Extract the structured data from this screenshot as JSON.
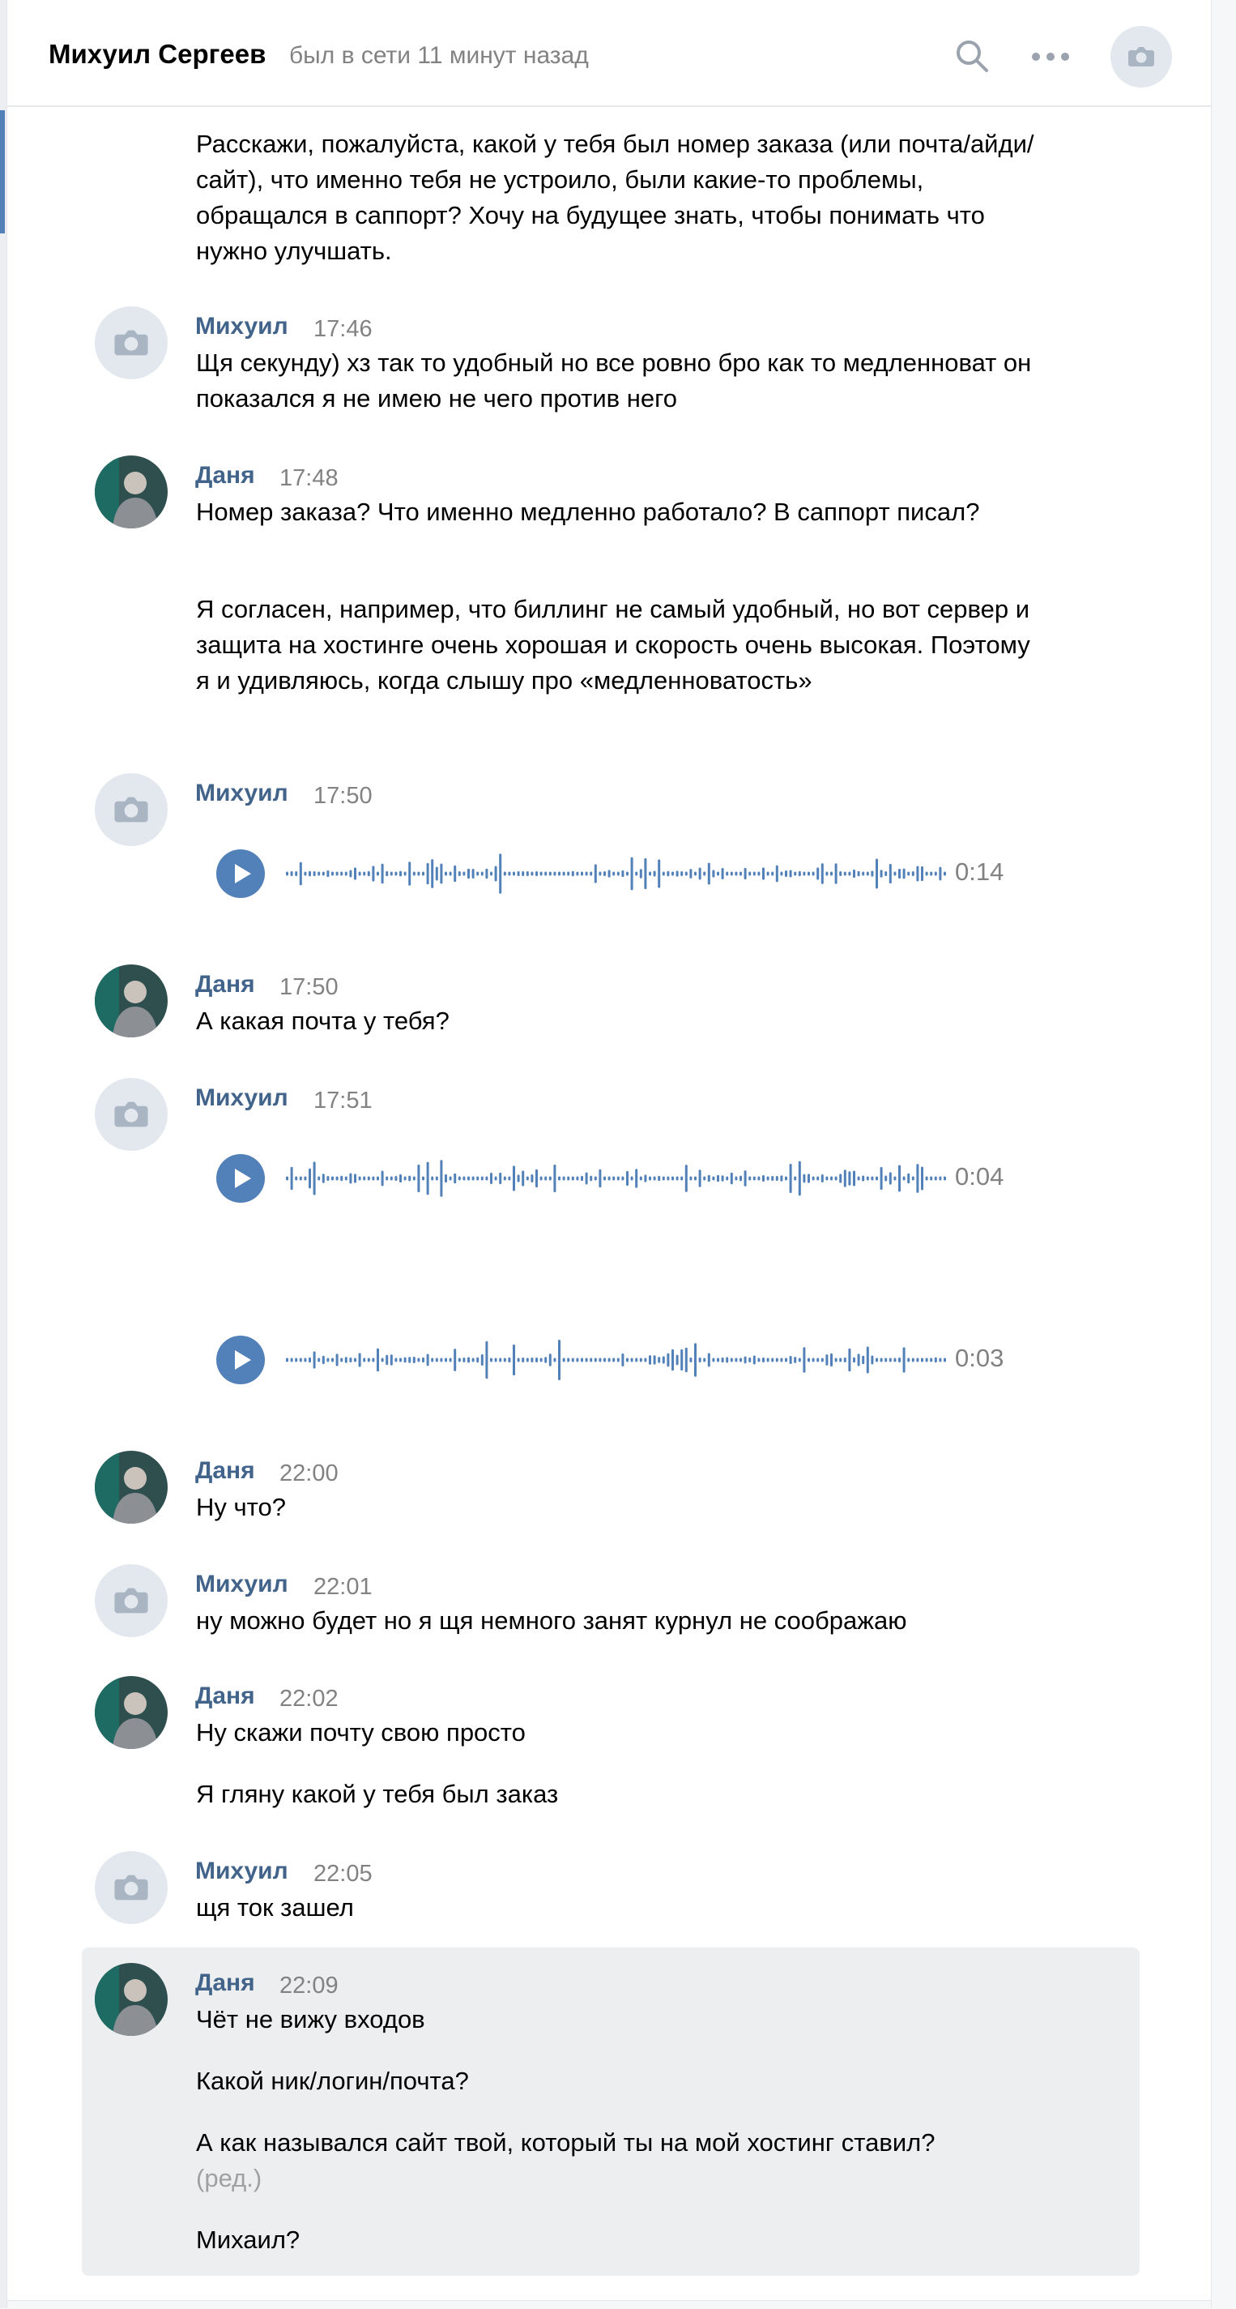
{
  "header": {
    "name": "Михуил Сергеев",
    "status": "был в сети 11 минут назад"
  },
  "colors": {
    "accent": "#5181b8",
    "author": "#42648b",
    "meta": "#828282",
    "highlight_bg": "#edeef0"
  },
  "icons": [
    "search-icon",
    "more-icon",
    "camera-icon",
    "play-icon"
  ],
  "messages": [
    {
      "text": "Расскажи, пожалуйста, какой у тебя был номер заказа (или почта/айди/сайт), что именно тебя не устроило, были какие-то проблемы, обращался в саппорт? Хочу на будущее знать, чтобы понимать что нужно улучшать."
    },
    {
      "author": "Михуил",
      "time": "17:46",
      "text": "Щя секунду) хз так то удобный но все ровно бро как то медленноват он показался я не имею не чего против него"
    },
    {
      "author": "Даня",
      "time": "17:48",
      "text": "Номер заказа? Что именно медленно работало? В саппорт писал?",
      "text2": "Я согласен, например, что биллинг не самый удобный, но вот сервер и защита на хостинге очень хорошая и скорость очень высокая. Поэтому я и удивляюсь, когда слышу про «медленноватость»"
    },
    {
      "author": "Михуил",
      "time": "17:50",
      "voice_duration": "0:14"
    },
    {
      "author": "Даня",
      "time": "17:50",
      "text": "А какая почта у тебя?"
    },
    {
      "author": "Михуил",
      "time": "17:51",
      "voice_duration": "0:04",
      "voice_duration2": "0:03"
    },
    {
      "author": "Даня",
      "time": "22:00",
      "text": "Ну что?"
    },
    {
      "author": "Михуил",
      "time": "22:01",
      "text": "ну можно будет но я щя немного занят курнул не соображаю"
    },
    {
      "author": "Даня",
      "time": "22:02",
      "text": "Ну скажи почту свою просто",
      "text2": "Я гляну какой у тебя был заказ"
    },
    {
      "author": "Михуил",
      "time": "22:05",
      "text": "щя ток зашел"
    },
    {
      "author": "Даня",
      "time": "22:09",
      "text": "Чёт не вижу входов",
      "text2": "Какой ник/логин/почта?",
      "text3": "А как назывался сайт твой, который ты на мой хостинг ставил?",
      "edited": "(ред.)",
      "text4": "Михаил?"
    }
  ]
}
